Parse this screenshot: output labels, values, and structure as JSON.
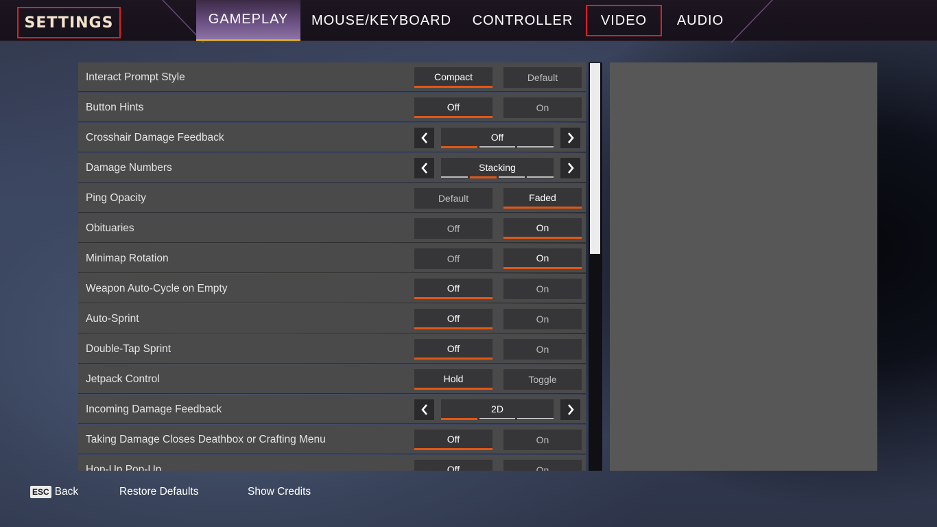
{
  "header": {
    "title": "SETTINGS",
    "tabs": [
      {
        "label": "GAMEPLAY",
        "active": true
      },
      {
        "label": "MOUSE/KEYBOARD"
      },
      {
        "label": "CONTROLLER"
      },
      {
        "label": "VIDEO",
        "highlighted": true
      },
      {
        "label": "AUDIO"
      }
    ]
  },
  "settings": {
    "rows": [
      {
        "label": "Interact Prompt Style",
        "type": "toggle",
        "options": [
          "Compact",
          "Default"
        ],
        "selected": 0
      },
      {
        "label": "Button Hints",
        "type": "toggle",
        "options": [
          "Off",
          "On"
        ],
        "selected": 0
      },
      {
        "label": "Crosshair Damage Feedback",
        "type": "cycle",
        "value": "Off",
        "segments": 3,
        "active_segment": 0
      },
      {
        "label": "Damage Numbers",
        "type": "cycle",
        "value": "Stacking",
        "segments": 4,
        "active_segment": 1
      },
      {
        "label": "Ping Opacity",
        "type": "toggle",
        "options": [
          "Default",
          "Faded"
        ],
        "selected": 1
      },
      {
        "label": "Obituaries",
        "type": "toggle",
        "options": [
          "Off",
          "On"
        ],
        "selected": 1
      },
      {
        "label": "Minimap Rotation",
        "type": "toggle",
        "options": [
          "Off",
          "On"
        ],
        "selected": 1
      },
      {
        "label": "Weapon Auto-Cycle on Empty",
        "type": "toggle",
        "options": [
          "Off",
          "On"
        ],
        "selected": 0
      },
      {
        "label": "Auto-Sprint",
        "type": "toggle",
        "options": [
          "Off",
          "On"
        ],
        "selected": 0
      },
      {
        "label": "Double-Tap Sprint",
        "type": "toggle",
        "options": [
          "Off",
          "On"
        ],
        "selected": 0
      },
      {
        "label": "Jetpack Control",
        "type": "toggle",
        "options": [
          "Hold",
          "Toggle"
        ],
        "selected": 0
      },
      {
        "label": "Incoming Damage Feedback",
        "type": "cycle",
        "value": "2D",
        "segments": 3,
        "active_segment": 0
      },
      {
        "label": "Taking Damage Closes Deathbox or Crafting Menu",
        "type": "toggle",
        "options": [
          "Off",
          "On"
        ],
        "selected": 0
      },
      {
        "label": "Hop-Up Pop-Up",
        "type": "toggle",
        "options": [
          "Off",
          "On"
        ],
        "selected": 0
      }
    ]
  },
  "footer": {
    "back_key": "ESC",
    "back_label": "Back",
    "restore_label": "Restore Defaults",
    "credits_label": "Show Credits"
  },
  "colors": {
    "accent": "#e25714",
    "highlight_box": "#e01e26",
    "tab_underline": "#d5a628"
  },
  "icons": {
    "left_arrow": "chevron-left-icon",
    "right_arrow": "chevron-right-icon"
  }
}
